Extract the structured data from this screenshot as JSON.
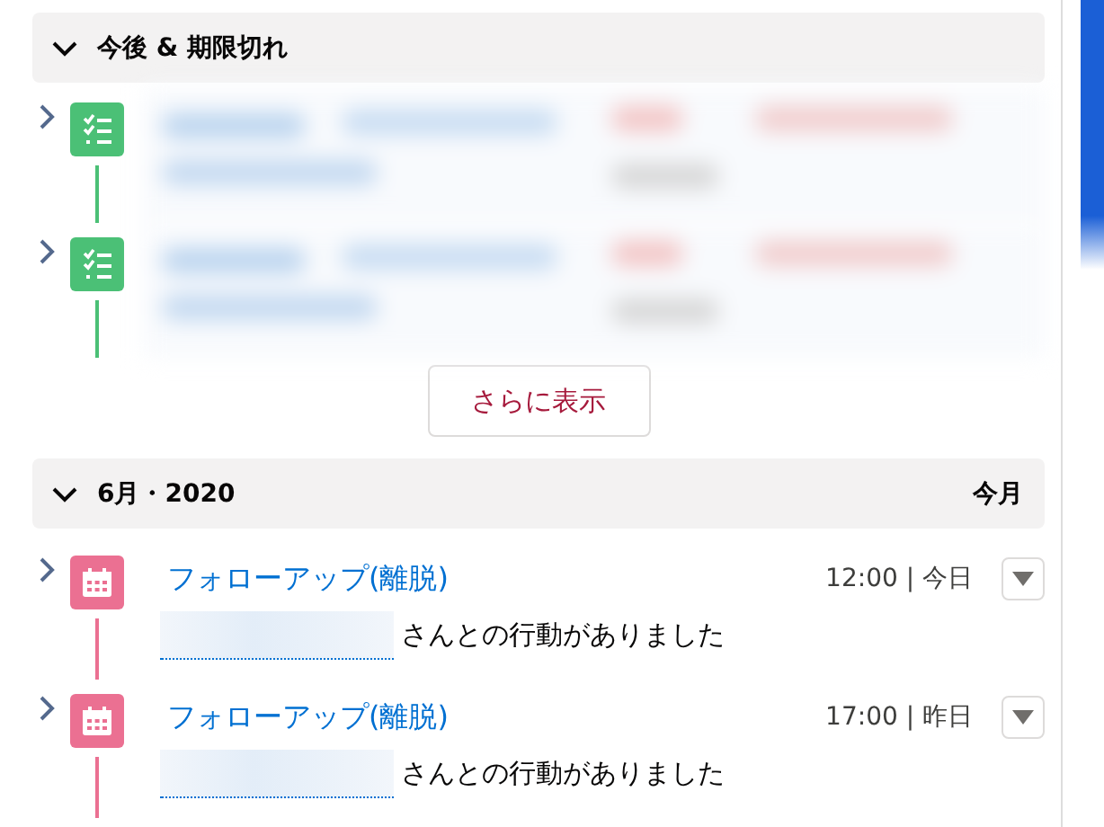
{
  "sections": [
    {
      "title": "今後 & 期限切れ",
      "expanded": true,
      "items": [
        {
          "kind": "task"
        },
        {
          "kind": "task"
        }
      ],
      "more_button": "さらに表示"
    },
    {
      "title": "6月・2020",
      "expanded": true,
      "badge": "今月",
      "items": [
        {
          "kind": "event",
          "title": "フォローアップ(離脱)",
          "time": "12:00 | 今日",
          "description": "さんとの行動がありました"
        },
        {
          "kind": "event",
          "title": "フォローアップ(離脱)",
          "time": "17:00 | 昨日",
          "description": "さんとの行動がありました"
        }
      ]
    }
  ]
}
